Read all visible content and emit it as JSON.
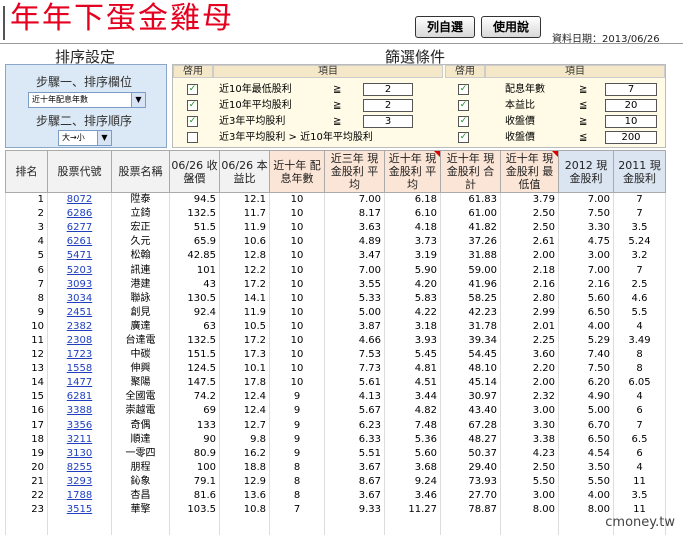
{
  "header": {
    "title": "年年下蛋金雞母",
    "btn_auto": "列自選",
    "btn_help": "使用說",
    "date_label": "資料日期：2013/06/26"
  },
  "sort": {
    "section_title": "排序設定",
    "step1_label": "步驟一、排序欄位",
    "step1_value": "近十年配息年數",
    "step2_label": "步驟二、排序順序",
    "step2_value": "大→小"
  },
  "filter": {
    "section_title": "篩選條件",
    "hdr_enable": "啓用",
    "hdr_item": "項目",
    "rows_left": [
      {
        "label": "近10年最低股利",
        "op": "≧",
        "value": "2",
        "checked": true
      },
      {
        "label": "近10年平均股利",
        "op": "≧",
        "value": "2",
        "checked": true
      },
      {
        "label": "近3年平均股利",
        "op": "≧",
        "value": "3",
        "checked": true
      },
      {
        "label": "近3年平均股利 > 近10年平均股利",
        "op": "",
        "value": "",
        "checked": false
      }
    ],
    "rows_right": [
      {
        "label": "配息年數",
        "op": "≧",
        "value": "7",
        "checked": true
      },
      {
        "label": "本益比",
        "op": "≦",
        "value": "20",
        "checked": true
      },
      {
        "label": "收盤價",
        "op": "≧",
        "value": "10",
        "checked": true
      },
      {
        "label": "收盤價",
        "op": "≦",
        "value": "200",
        "checked": true
      }
    ]
  },
  "table": {
    "columns": [
      "排名",
      "股票代號",
      "股票名稱",
      "06/26 收盤價",
      "06/26 本益比",
      "近十年 配息年數",
      "近三年 現金股利 平均",
      "近十年 現金股利 平均",
      "近十年 現金股利 合計",
      "近十年 現金股利 最低值",
      "2012 現金股利",
      "2011 現金股利"
    ],
    "rows": [
      [
        "1",
        "8072",
        "陞泰",
        "94.5",
        "12.1",
        "10",
        "7.00",
        "6.18",
        "61.83",
        "3.79",
        "7.00",
        "7"
      ],
      [
        "2",
        "6286",
        "立錡",
        "132.5",
        "11.7",
        "10",
        "8.17",
        "6.10",
        "61.00",
        "2.50",
        "7.50",
        "7"
      ],
      [
        "3",
        "6277",
        "宏正",
        "51.5",
        "11.9",
        "10",
        "3.63",
        "4.18",
        "41.82",
        "2.50",
        "3.30",
        "3.5"
      ],
      [
        "4",
        "6261",
        "久元",
        "65.9",
        "10.6",
        "10",
        "4.89",
        "3.73",
        "37.26",
        "2.61",
        "4.75",
        "5.24"
      ],
      [
        "5",
        "5471",
        "松翰",
        "42.85",
        "12.8",
        "10",
        "3.47",
        "3.19",
        "31.88",
        "2.00",
        "3.00",
        "3.2"
      ],
      [
        "6",
        "5203",
        "訊連",
        "101",
        "12.2",
        "10",
        "7.00",
        "5.90",
        "59.00",
        "2.18",
        "7.00",
        "7"
      ],
      [
        "7",
        "3093",
        "港建",
        "43",
        "17.2",
        "10",
        "3.55",
        "4.20",
        "41.96",
        "2.16",
        "2.16",
        "2.5"
      ],
      [
        "8",
        "3034",
        "聯詠",
        "130.5",
        "14.1",
        "10",
        "5.33",
        "5.83",
        "58.25",
        "2.80",
        "5.60",
        "4.6"
      ],
      [
        "9",
        "2451",
        "創見",
        "92.4",
        "11.9",
        "10",
        "5.00",
        "4.22",
        "42.23",
        "2.99",
        "6.50",
        "5.5"
      ],
      [
        "10",
        "2382",
        "廣達",
        "63",
        "10.5",
        "10",
        "3.87",
        "3.18",
        "31.78",
        "2.01",
        "4.00",
        "4"
      ],
      [
        "11",
        "2308",
        "台達電",
        "132.5",
        "17.2",
        "10",
        "4.66",
        "3.93",
        "39.34",
        "2.25",
        "5.29",
        "3.49"
      ],
      [
        "12",
        "1723",
        "中碳",
        "151.5",
        "17.3",
        "10",
        "7.53",
        "5.45",
        "54.45",
        "3.60",
        "7.40",
        "8"
      ],
      [
        "13",
        "1558",
        "伸興",
        "124.5",
        "10.1",
        "10",
        "7.73",
        "4.81",
        "48.10",
        "2.20",
        "7.50",
        "8"
      ],
      [
        "14",
        "1477",
        "聚陽",
        "147.5",
        "17.8",
        "10",
        "5.61",
        "4.51",
        "45.14",
        "2.00",
        "6.20",
        "6.05"
      ],
      [
        "15",
        "6281",
        "全國電",
        "74.2",
        "12.4",
        "9",
        "4.13",
        "3.44",
        "30.97",
        "2.32",
        "4.90",
        "4"
      ],
      [
        "16",
        "3388",
        "崇越電",
        "69",
        "12.4",
        "9",
        "5.67",
        "4.82",
        "43.40",
        "3.00",
        "5.00",
        "6"
      ],
      [
        "17",
        "3356",
        "奇偶",
        "133",
        "12.7",
        "9",
        "6.23",
        "7.48",
        "67.28",
        "3.30",
        "6.70",
        "7"
      ],
      [
        "18",
        "3211",
        "順達",
        "90",
        "9.8",
        "9",
        "6.33",
        "5.36",
        "48.27",
        "3.38",
        "6.50",
        "6.5"
      ],
      [
        "19",
        "3130",
        "一零四",
        "80.9",
        "16.2",
        "9",
        "5.51",
        "5.60",
        "50.37",
        "4.23",
        "4.54",
        "6"
      ],
      [
        "20",
        "8255",
        "朋程",
        "100",
        "18.8",
        "8",
        "3.67",
        "3.68",
        "29.40",
        "2.50",
        "3.50",
        "4"
      ],
      [
        "21",
        "3293",
        "鈊象",
        "79.1",
        "12.9",
        "8",
        "8.67",
        "9.24",
        "73.93",
        "5.50",
        "5.50",
        "11"
      ],
      [
        "22",
        "1788",
        "杏昌",
        "81.6",
        "13.6",
        "8",
        "3.67",
        "3.46",
        "27.70",
        "3.00",
        "4.00",
        "3.5"
      ],
      [
        "23",
        "3515",
        "華擎",
        "103.5",
        "10.8",
        "7",
        "9.33",
        "11.27",
        "78.87",
        "8.00",
        "8.00",
        "11"
      ]
    ]
  },
  "watermark": "cmoney.tw"
}
